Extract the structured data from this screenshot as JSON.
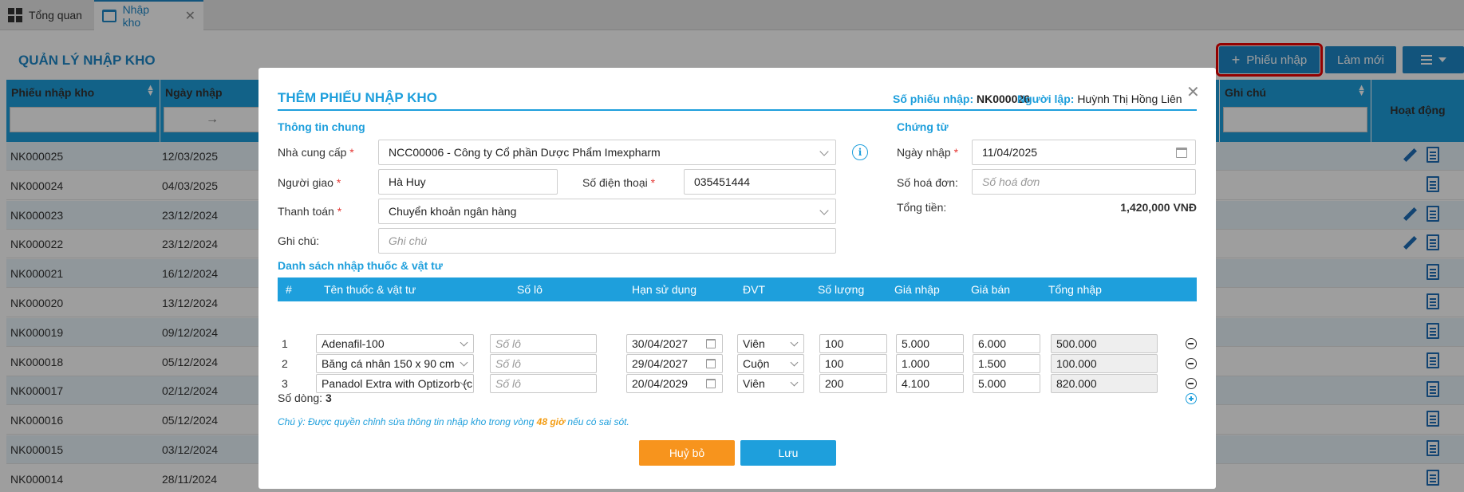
{
  "tabs": [
    {
      "label": "Tổng quan"
    },
    {
      "label": "Nhập kho"
    }
  ],
  "page": {
    "title": "QUẢN LÝ NHẬP KHO",
    "add_button": "Phiếu nhập",
    "refresh_button": "Làm mới"
  },
  "table": {
    "columns": [
      "Phiếu nhập kho",
      "Ngày nhập",
      "Ghi chú",
      "Hoạt động"
    ],
    "date_filter_arrow": "→",
    "rows": [
      {
        "code": "NK000025",
        "date": "12/03/2025"
      },
      {
        "code": "NK000024",
        "date": "04/03/2025"
      },
      {
        "code": "NK000023",
        "date": "23/12/2024"
      },
      {
        "code": "NK000022",
        "date": "23/12/2024"
      },
      {
        "code": "NK000021",
        "date": "16/12/2024"
      },
      {
        "code": "NK000020",
        "date": "13/12/2024"
      },
      {
        "code": "NK000019",
        "date": "09/12/2024"
      },
      {
        "code": "NK000018",
        "date": "05/12/2024"
      },
      {
        "code": "NK000017",
        "date": "02/12/2024"
      },
      {
        "code": "NK000016",
        "date": "05/12/2024"
      },
      {
        "code": "NK000015",
        "date": "03/12/2024"
      },
      {
        "code": "NK000014",
        "date": "28/11/2024"
      }
    ]
  },
  "modal": {
    "title": "THÊM PHIẾU NHẬP KHO",
    "receipt_no_label": "Số phiếu nhập:",
    "receipt_no": "NK000026",
    "creator_label": "Người lập:",
    "creator": "Huỳnh Thị Hồng Liên",
    "general_section": "Thông tin chung",
    "supplier_label": "Nhà cung cấp",
    "supplier_value": "NCC00006 - Công ty Cổ phần Dược Phẩm Imexpharm",
    "deliverer_label": "Người giao",
    "deliverer_value": "Hà Huy",
    "phone_label": "Số điện thoại",
    "phone_value": "035451444",
    "payment_label": "Thanh toán",
    "payment_value": "Chuyển khoản ngân hàng",
    "note_label": "Ghi chú",
    "note_placeholder": "Ghi chú",
    "voucher_section": "Chứng từ",
    "date_label": "Ngày nhập",
    "date_value": "11/04/2025",
    "invoice_label": "Số hoá đơn",
    "invoice_placeholder": "Số hoá đơn",
    "total_label": "Tổng tiền:",
    "total_value": "1,420,000 VNĐ",
    "items_section": "Danh sách nhập thuốc & vật tư",
    "item_columns": [
      "#",
      "Tên thuốc & vật tư",
      "Số lô",
      "Hạn sử dụng",
      "ĐVT",
      "Số lượng",
      "Giá nhập",
      "Giá bán",
      "Tổng nhập"
    ],
    "items": [
      {
        "no": "1",
        "name": "Adenafil-100",
        "lot_placeholder": "Số lô",
        "expiry": "30/04/2027",
        "unit": "Viên",
        "qty": "100",
        "cost": "5.000",
        "price": "6.000",
        "total": "500.000"
      },
      {
        "no": "2",
        "name": "Băng cá nhân 150 x 90 cm",
        "lot_placeholder": "Số lô",
        "expiry": "29/04/2027",
        "unit": "Cuộn",
        "qty": "100",
        "cost": "1.000",
        "price": "1.500",
        "total": "100.000"
      },
      {
        "no": "3",
        "name": "Panadol Extra with Optizorb (c...",
        "lot_placeholder": "Số lô",
        "expiry": "20/04/2029",
        "unit": "Viên",
        "qty": "200",
        "cost": "4.100",
        "price": "5.000",
        "total": "820.000"
      }
    ],
    "row_count_label": "Số dòng:",
    "row_count": "3",
    "note_prefix": "Chú ý: Được quyền chỉnh sửa thông tin nhập kho trong vòng",
    "note_highlight": "48 giờ",
    "note_suffix": "nếu có sai sót.",
    "cancel_button": "Huỷ bỏ",
    "save_button": "Lưu"
  }
}
